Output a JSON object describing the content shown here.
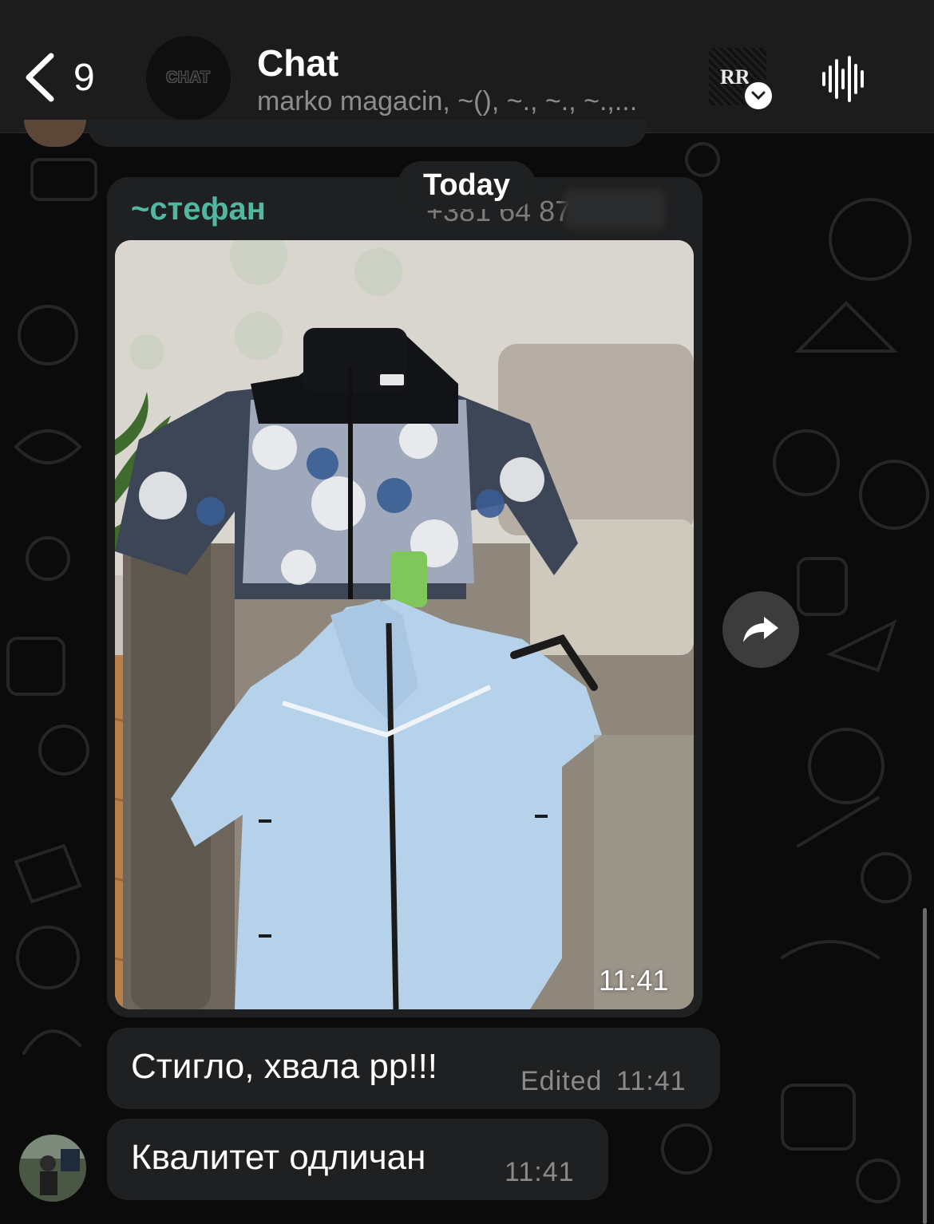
{
  "header": {
    "back_count": "9",
    "title": "Chat",
    "subtitle": "marko magacin, ~(), ~., ~., ~.,...",
    "avatar_text": "CHAT",
    "profile_badge_text": "RR"
  },
  "date_divider": "Today",
  "media_message": {
    "sender": "~стефан",
    "phone": "+381 64 87",
    "time": "11:41",
    "image_alt": "Photo of The North Face puffer jacket and light blue Nike tech fleece on a sofa"
  },
  "messages": [
    {
      "text": "Стигло, хвала рр!!!",
      "edited_label": "Edited",
      "time": "11:41"
    },
    {
      "text": "Квалитет одличан",
      "time": "11:41"
    }
  ],
  "colors": {
    "header_bg": "#1c1c1d",
    "bubble_bg": "#1f2021",
    "sender_name": "#52b7a0",
    "meta_text": "#8a8a8a"
  },
  "icons": [
    "chevron-left-icon",
    "waveform-icon",
    "forward-icon",
    "chevron-down-icon"
  ]
}
